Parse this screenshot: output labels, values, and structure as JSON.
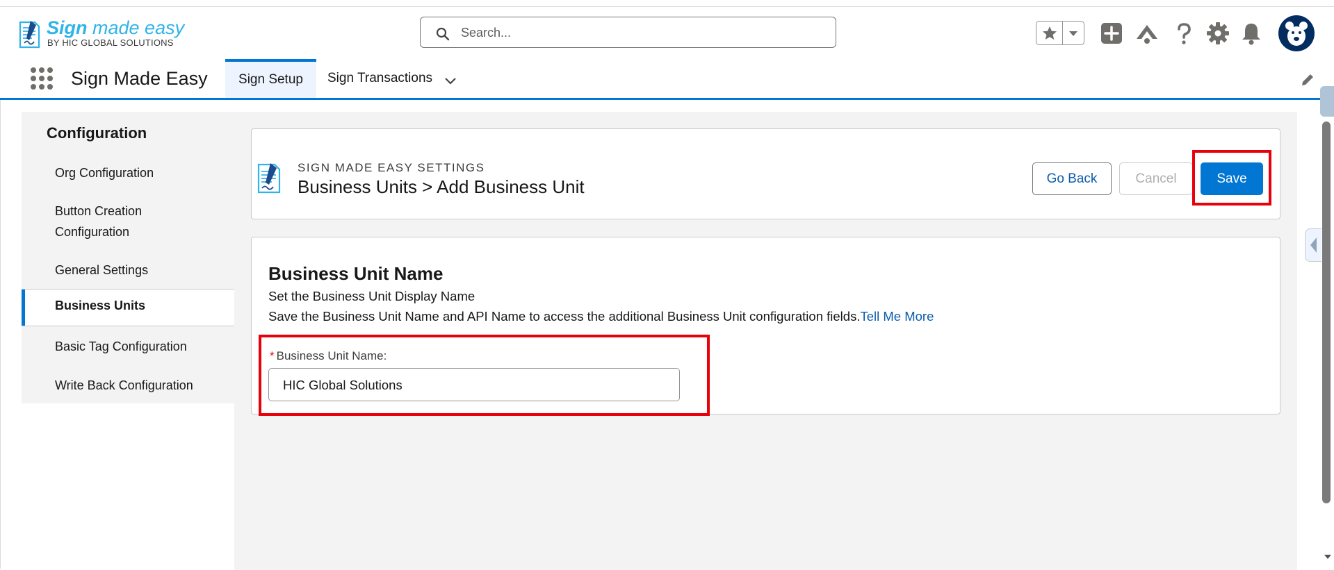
{
  "brand": {
    "logo_title_bold": "Sign",
    "logo_title_light": "made easy",
    "logo_subtitle": "BY HIC GLOBAL SOLUTIONS",
    "accent": "#2fb3e9"
  },
  "header": {
    "search_placeholder": "Search...",
    "icons": [
      "favorites-star-icon",
      "add-icon",
      "trailhead-icon",
      "help-icon",
      "setup-gear-icon",
      "notifications-bell-icon",
      "avatar"
    ]
  },
  "nav": {
    "app_name": "Sign Made Easy",
    "tabs": [
      {
        "label": "Sign Setup",
        "active": true
      },
      {
        "label": "Sign Transactions",
        "active": false
      }
    ],
    "brand_color": "#0176d3"
  },
  "sidebar": {
    "title": "Configuration",
    "items": [
      {
        "label": "Org Configuration"
      },
      {
        "label": "Button Creation Configuration"
      },
      {
        "label": "General Settings"
      },
      {
        "label": "Business Units",
        "active": true
      },
      {
        "label": "Basic Tag Configuration"
      },
      {
        "label": "Write Back Configuration"
      }
    ]
  },
  "page_header": {
    "eyebrow": "SIGN MADE EASY SETTINGS",
    "title": "Business Units > Add Business Unit",
    "buttons": {
      "go_back": "Go Back",
      "cancel": "Cancel",
      "save": "Save"
    }
  },
  "form": {
    "section_title": "Business Unit Name",
    "line1": "Set the Business Unit Display Name",
    "line2": "Save the Business Unit Name and API Name to access the additional Business Unit configuration fields.",
    "link": "Tell Me More",
    "required_mark": "*",
    "field_label": "Business Unit Name:",
    "field_value": "HIC Global Solutions"
  },
  "highlight_color": "#e8000b"
}
